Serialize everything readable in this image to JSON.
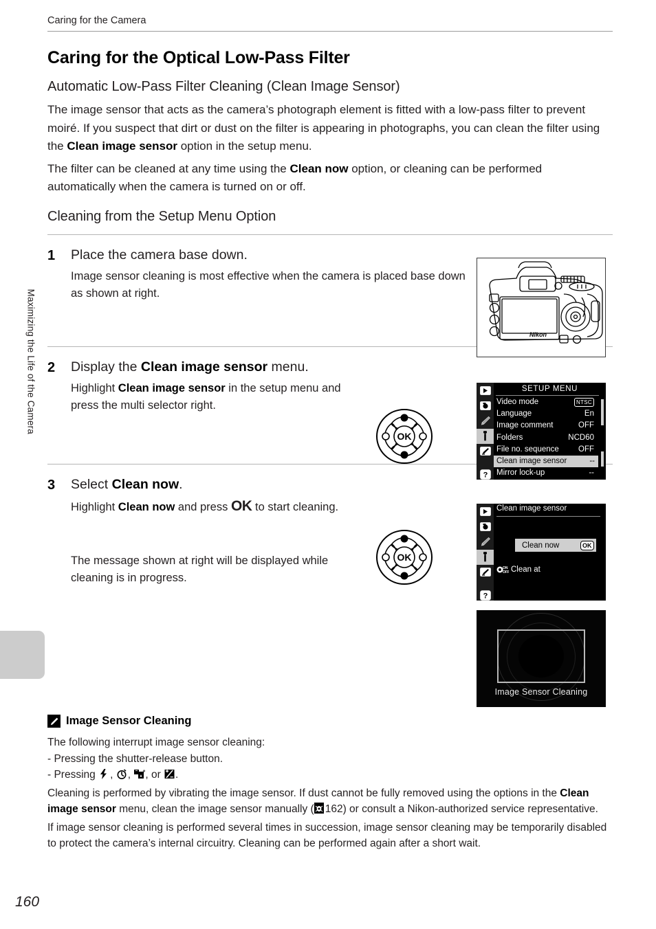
{
  "page": {
    "running_head": "Caring for the Camera",
    "page_number": "160",
    "chapter_tab": "Maximizing the Life of the Camera"
  },
  "section": {
    "title": "Caring for the Optical Low-Pass Filter",
    "subtitle_1": "Automatic Low-Pass Filter Cleaning (Clean Image Sensor)",
    "para_1_a": "The image sensor that acts as the camera’s photograph element is fitted with a low-pass filter to prevent moiré. If you suspect that dirt or dust on the filter is appearing in photographs, you can clean the filter using the ",
    "para_1_bold": "Clean image sensor",
    "para_1_b": " option in the setup menu.",
    "para_2_a": "The filter can be cleaned at any time using the ",
    "para_2_bold": "Clean now",
    "para_2_b": " option, or cleaning can be performed automatically when the camera is turned on or off.",
    "subtitle_2": "Cleaning from the Setup Menu Option"
  },
  "steps": [
    {
      "number": "1",
      "heading": "Place the camera base down.",
      "text": "Image sensor cleaning is most effective when the camera is placed base down as shown at right."
    },
    {
      "number": "2",
      "heading_a": "Display the ",
      "heading_bold": "Clean image sensor",
      "heading_b": " menu.",
      "text_a": "Highlight ",
      "text_bold": "Clean image sensor",
      "text_b": " in the setup menu and press the multi selector right."
    },
    {
      "number": "3",
      "heading_a": "Select ",
      "heading_bold": "Clean now",
      "heading_b": ".",
      "text_a": "Highlight ",
      "text_bold": "Clean now",
      "text_b": " and press ",
      "text_ok": "OK",
      "text_c": " to start cleaning.",
      "text2": "The message shown at right will be displayed while cleaning is in progress."
    }
  ],
  "setup_menu": {
    "title": "SETUP MENU",
    "sidebar_icons": [
      {
        "name": "playback-icon"
      },
      {
        "name": "shooting-menu-icon"
      },
      {
        "name": "custom-settings-pencil-icon"
      },
      {
        "name": "setup-wrench-icon"
      },
      {
        "name": "retouch-brush-icon"
      },
      {
        "name": "help-question-icon"
      }
    ],
    "rows": [
      {
        "label": "Video mode",
        "value": "NTSC",
        "value_style": "badge",
        "highlighted": false
      },
      {
        "label": "Language",
        "value": "En",
        "value_style": "plain",
        "highlighted": false
      },
      {
        "label": "Image comment",
        "value": "OFF",
        "value_style": "plain",
        "highlighted": false
      },
      {
        "label": "Folders",
        "value": "NCD60",
        "value_style": "small",
        "highlighted": false
      },
      {
        "label": "File no. sequence",
        "value": "OFF",
        "value_style": "plain",
        "highlighted": false
      },
      {
        "label": "Clean image sensor",
        "value": "--",
        "value_style": "plain",
        "highlighted": true
      },
      {
        "label": "Mirror lock-up",
        "value": "--",
        "value_style": "plain",
        "highlighted": false
      }
    ]
  },
  "clean_sensor_menu": {
    "title": "Clean image sensor",
    "clean_now_label": "Clean now",
    "ok_badge": "OK",
    "clean_at_label": "Clean at",
    "clean_at_icon": "on-off-toggle-icon"
  },
  "cleaning_message": {
    "caption": "Image Sensor Cleaning"
  },
  "note": {
    "icon": "note-pencil-icon",
    "title": "Image Sensor Cleaning",
    "line_1": "The following interrupt image sensor cleaning:",
    "line_2": "- Pressing the shutter-release button.",
    "line_3_a": "- Pressing ",
    "line_3_icons": [
      "flash-icon",
      "self-timer-icon",
      "flash-mode-icon",
      "exposure-compensation-icon"
    ],
    "line_3_sep1": ", ",
    "line_3_sep2": ", ",
    "line_3_sep3": ", or ",
    "line_3_end": ".",
    "para_a": "Cleaning is performed by vibrating the image sensor. If dust cannot be fully removed using the options in the ",
    "para_bold": "Clean image sensor",
    "para_b": " menu, clean the image sensor manually (",
    "para_ref_icon": "page-reference-icon",
    "para_ref_page": "162",
    "para_c": ") or consult a Nikon-authorized service representative.",
    "para2": "If image sensor cleaning is performed several times in succession, image sensor cleaning may be temporarily disabled to protect the camera’s internal circuitry. Cleaning can be performed again after a short wait."
  },
  "camera_illustration": {
    "brand_text": "Nikon"
  },
  "multi_selector": {
    "ok_label": "OK"
  },
  "colors": {
    "text": "#231f20",
    "rule": "#b5b5b5",
    "tab_gray": "#cccccc",
    "menu_highlight": "#cfcfcf",
    "lcd_black": "#000000"
  }
}
